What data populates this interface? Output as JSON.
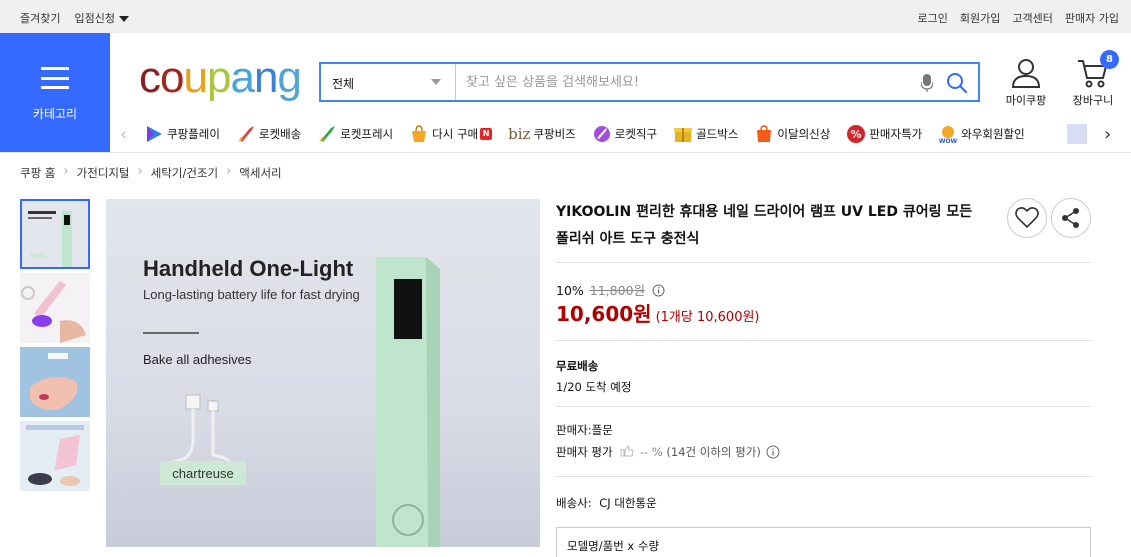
{
  "topbar": {
    "left": [
      "즐겨찾기",
      "입점신청"
    ],
    "right": [
      "로그인",
      "회원가입",
      "고객센터",
      "판매자 가입"
    ]
  },
  "category": {
    "label": "카테고리"
  },
  "logo": {
    "text": "coupang"
  },
  "search": {
    "scope": "전체",
    "placeholder": "찾고 싶은 상품을 검색해보세요!"
  },
  "user": {
    "mypage": "마이쿠팡",
    "cart": "장바구니",
    "cart_count": "8"
  },
  "menu": [
    {
      "label": "쿠팡플레이",
      "icon": "coupang-play-icon"
    },
    {
      "label": "로켓배송",
      "icon": "rocket-delivery-icon"
    },
    {
      "label": "로켓프레시",
      "icon": "rocket-fresh-icon"
    },
    {
      "label": "다시 구매",
      "icon": "rebuy-icon",
      "badge": "N"
    },
    {
      "label": "쿠팡비즈",
      "icon": "biz-icon",
      "prefix": "biz"
    },
    {
      "label": "로켓직구",
      "icon": "rocket-global-icon"
    },
    {
      "label": "골드박스",
      "icon": "goldbox-icon"
    },
    {
      "label": "이달의신상",
      "icon": "new-arrivals-icon"
    },
    {
      "label": "판매자특가",
      "icon": "seller-deal-icon"
    },
    {
      "label": "와우회원할인",
      "icon": "wow-discount-icon"
    }
  ],
  "breadcrumb": [
    "쿠팡 홈",
    "가전디지털",
    "세탁기/건조기",
    "액세서리"
  ],
  "product": {
    "title": "YIKOOLIN 편리한 휴대용 네일 드라이어 램프 UV LED 큐어링 모든 폴리쉬 아트 도구 충전식",
    "discount": "10%",
    "original_price": "11,800원",
    "price": "10,600원",
    "unit_price": "(1개당 10,600원)",
    "shipping_title": "무료배송",
    "arrival": "1/20 도착 예정",
    "seller": "판매자:플문",
    "rating_label": "판매자 평가",
    "rating_value": "-- %",
    "rating_note": "(14건 이하의 평가)",
    "carrier_label": "배송사:",
    "carrier": "CJ 대한통운",
    "option_label": "모델명/품번 x 수량"
  },
  "image": {
    "headline": "Handheld One-Light",
    "sub": "Long-lasting battery life for fast drying",
    "line2": "Bake all adhesives",
    "color_tag": "chartreuse"
  },
  "colors": {
    "accent": "#346aff",
    "price": "#ae0000",
    "search_border": "#4285f4"
  }
}
